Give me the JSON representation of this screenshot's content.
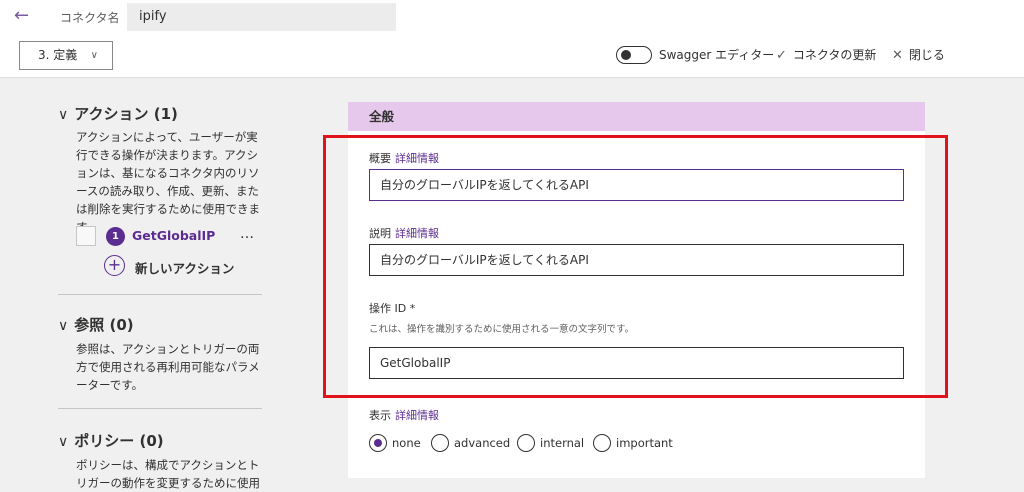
{
  "header": {
    "back_icon": "arrow-left-icon",
    "connector_label": "コネクタ名",
    "connector_name": "ipify"
  },
  "toolbar": {
    "step_dropdown": "3. 定義",
    "swagger_toggle_label": "Swagger エディター",
    "swagger_toggle_on": false,
    "update_label": "コネクタの更新",
    "close_label": "閉じる"
  },
  "left_pane": {
    "actions": {
      "title": "アクション (1)",
      "description": "アクションによって、ユーザーが実行できる操作が決まります。アクションは、基になるコネクタ内のリソースの読み取り、作成、更新、または削除を実行するために使用できます。",
      "items": [
        {
          "number": "1",
          "name": "GetGlobalIP",
          "more": "…"
        }
      ],
      "new_action_label": "新しいアクション"
    },
    "references": {
      "title": "参照 (0)",
      "description": "参照は、アクションとトリガーの両方で使用される再利用可能なパラメーターです。"
    },
    "policies": {
      "title": "ポリシー (0)",
      "description": "ポリシーは、構成でアクションとトリガーの動作を変更するために使用され"
    }
  },
  "form": {
    "section_title": "全般",
    "summary": {
      "label": "概要",
      "link": "詳細情報",
      "value": "自分のグローバルIPを返してくれるAPI"
    },
    "description": {
      "label": "説明",
      "link": "詳細情報",
      "value": "自分のグローバルIPを返してくれるAPI"
    },
    "operation_id": {
      "label": "操作 ID *",
      "hint": "これは、操作を識別するために使用される一意の文字列です。",
      "value": "GetGlobalIP"
    },
    "visibility": {
      "label": "表示",
      "link": "詳細情報",
      "options": [
        "none",
        "advanced",
        "internal",
        "important"
      ],
      "selected": "none"
    }
  },
  "colors": {
    "accent": "#5c2d91",
    "section_header_bg": "#e6c8ed",
    "highlight_border": "#e0131c",
    "pane_bg": "#f0f0f0"
  }
}
